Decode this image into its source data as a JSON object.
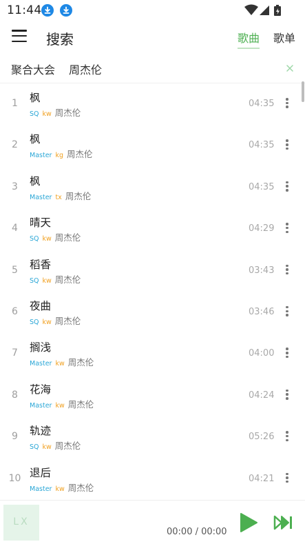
{
  "status_bar": {
    "time": "11:44"
  },
  "app_bar": {
    "title": "搜索",
    "tabs": [
      {
        "label": "歌曲",
        "active": true
      },
      {
        "label": "歌单",
        "active": false
      }
    ]
  },
  "search": {
    "source": "聚合大会",
    "query": "周杰伦"
  },
  "songs": [
    {
      "index": "1",
      "name": "枫",
      "quality": "SQ",
      "source": "kw",
      "singer": "周杰伦",
      "duration": "04:35"
    },
    {
      "index": "2",
      "name": "枫",
      "quality": "Master",
      "source": "kg",
      "singer": "周杰伦",
      "duration": "04:35"
    },
    {
      "index": "3",
      "name": "枫",
      "quality": "Master",
      "source": "tx",
      "singer": "周杰伦",
      "duration": "04:35"
    },
    {
      "index": "4",
      "name": "晴天",
      "quality": "SQ",
      "source": "kw",
      "singer": "周杰伦",
      "duration": "04:29"
    },
    {
      "index": "5",
      "name": "稻香",
      "quality": "SQ",
      "source": "kw",
      "singer": "周杰伦",
      "duration": "03:43"
    },
    {
      "index": "6",
      "name": "夜曲",
      "quality": "SQ",
      "source": "kw",
      "singer": "周杰伦",
      "duration": "03:46"
    },
    {
      "index": "7",
      "name": "搁浅",
      "quality": "Master",
      "source": "kw",
      "singer": "周杰伦",
      "duration": "04:00"
    },
    {
      "index": "8",
      "name": "花海",
      "quality": "Master",
      "source": "kw",
      "singer": "周杰伦",
      "duration": "04:24"
    },
    {
      "index": "9",
      "name": "轨迹",
      "quality": "SQ",
      "source": "kw",
      "singer": "周杰伦",
      "duration": "05:26"
    },
    {
      "index": "10",
      "name": "退后",
      "quality": "Master",
      "source": "kw",
      "singer": "周杰伦",
      "duration": "04:21"
    }
  ],
  "player": {
    "cover_text": "LX",
    "time": "00:00 / 00:00"
  },
  "colors": {
    "accent": "#4caf50",
    "quality": "#29a6d6",
    "source": "#f0a020",
    "download_badge": "#1e88e5"
  },
  "icons": [
    "download-icon",
    "wifi-icon",
    "signal-icon",
    "battery-icon",
    "menu-icon",
    "clear-icon",
    "more-vert-icon",
    "play-icon",
    "skip-next-icon"
  ]
}
